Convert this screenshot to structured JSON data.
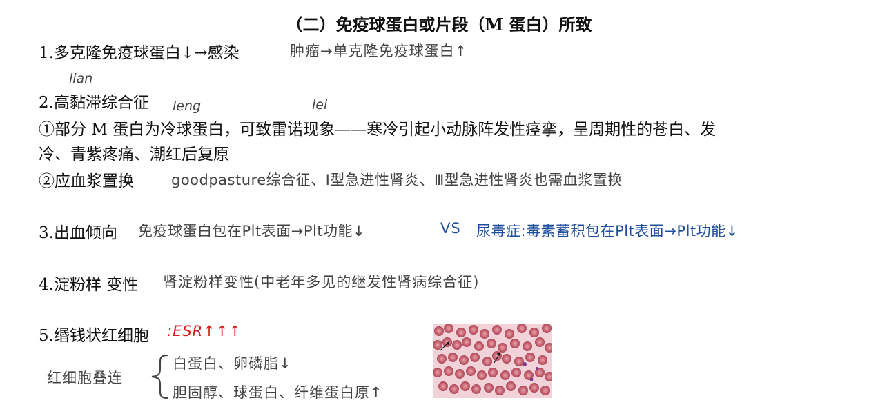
{
  "title": "（二）免疫球蛋白或片段（M 蛋白）所致",
  "items": {
    "i1": {
      "label": "1.多克隆免疫球蛋白↓→感染",
      "note": "肿瘤→单克隆免疫球蛋白↑"
    },
    "i2": {
      "label": "2.高黏滞综合征",
      "pinyin_lian": "lian",
      "pinyin_leng": "leng",
      "pinyin_lei": "lei",
      "sub1_line1": "①部分 M 蛋白为冷球蛋白，可致雷诺现象——寒冷引起小动脉阵发性痉挛，呈周期性的苍白、发",
      "sub1_line2": "冷、青紫疼痛、潮红后复原",
      "sub2_label": "②应血浆置换",
      "sub2_note": "goodpasture综合征、Ⅰ型急进性肾炎、Ⅲ型急进性肾炎也需血浆置换"
    },
    "i3": {
      "label": "3.出血倾向",
      "note": "免疫球蛋白包在Plt表面→Plt功能↓",
      "vs": "VS",
      "note_blue": "尿毒症:毒素蓄积包在Plt表面→Plt功能↓"
    },
    "i4": {
      "label": "4.淀粉样 变性",
      "note": "肾淀粉样变性(中老年多见的继发性肾病综合征)"
    },
    "i5": {
      "label": "5.缗钱状红细胞",
      "note_red": ":ESR↑↑↑",
      "brace_label": "红细胞叠连",
      "brace_top": "白蛋白、卵磷脂↓",
      "brace_bottom": "胆固醇、球蛋白、纤维蛋白原↑"
    }
  },
  "colors": {
    "text": "#111111",
    "handwriting": "#444444",
    "blue": "#1f4e9c",
    "red": "#d62020",
    "slide_bg": "#f1d2d8",
    "cell": "#c9626e"
  }
}
